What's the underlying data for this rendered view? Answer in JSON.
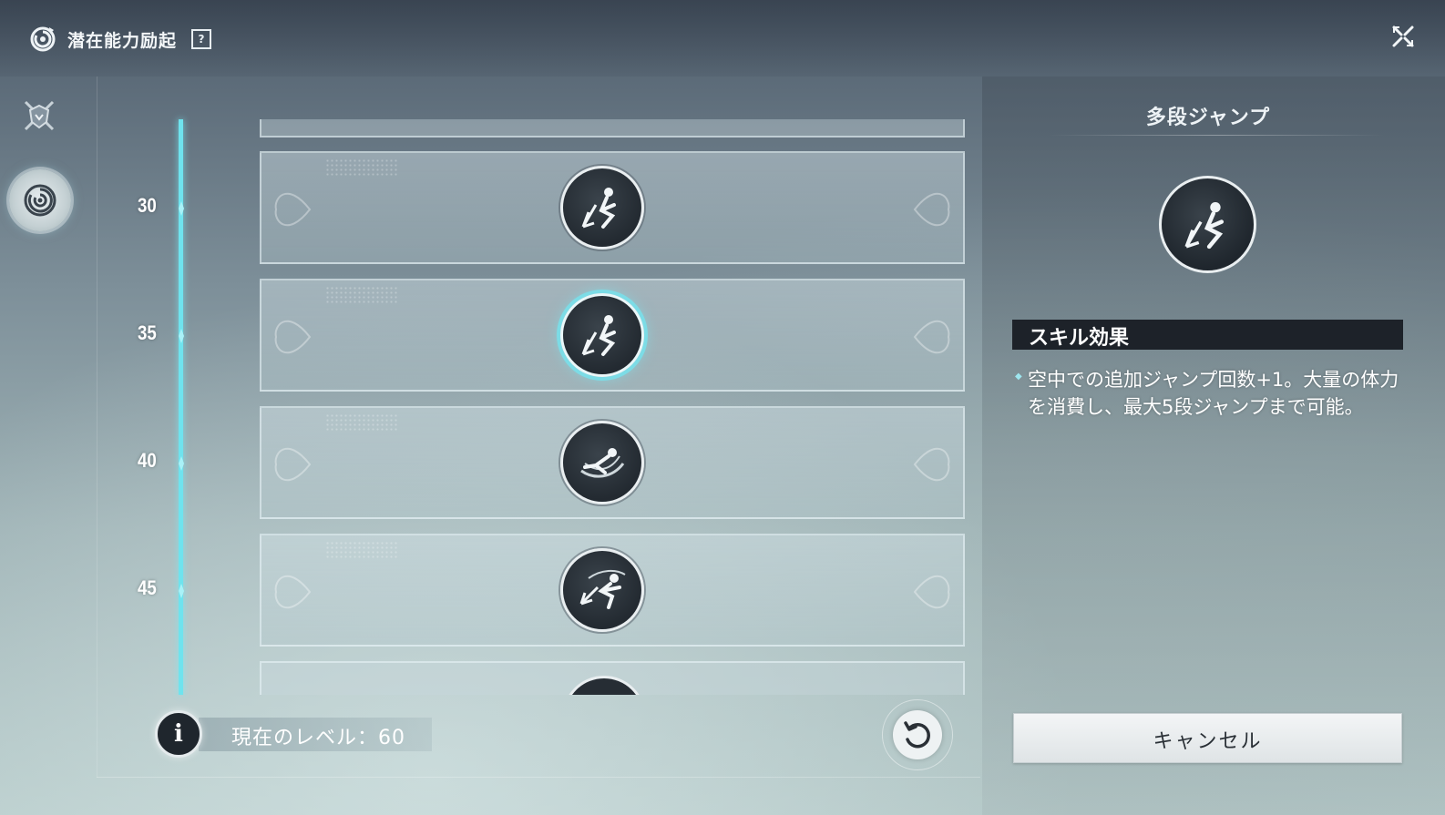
{
  "header": {
    "title": "潜在能力励起",
    "help_label": "?",
    "icons": {
      "title": "swirl-emblem-icon",
      "help": "question-mark-icon",
      "close": "close-x-icon"
    }
  },
  "sidebar": {
    "tabs": [
      {
        "icon": "crossed-swords-shield-icon",
        "active": false
      },
      {
        "icon": "swirl-emblem-icon",
        "active": true
      }
    ]
  },
  "timeline": {
    "levels": [
      "30",
      "35",
      "40",
      "45"
    ],
    "color": "#6fe3ee"
  },
  "skills": [
    {
      "level": "30",
      "icon": "multi-jump-icon",
      "selected": false
    },
    {
      "level": "35",
      "icon": "multi-jump-icon",
      "selected": true
    },
    {
      "level": "40",
      "icon": "dash-slide-icon",
      "selected": false
    },
    {
      "level": "45",
      "icon": "aerial-kick-icon",
      "selected": false
    }
  ],
  "footer": {
    "info_label": "i",
    "current_level_text": "現在のレベル：60",
    "reset_icon": "reset-icon"
  },
  "detail": {
    "skill_name": "多段ジャンプ",
    "effect_header": "スキル効果",
    "effect_description": "空中での追加ジャンプ回数+1。大量の体力を消費し、最大5段ジャンプまで可能。",
    "cancel_label": "キャンセル"
  }
}
